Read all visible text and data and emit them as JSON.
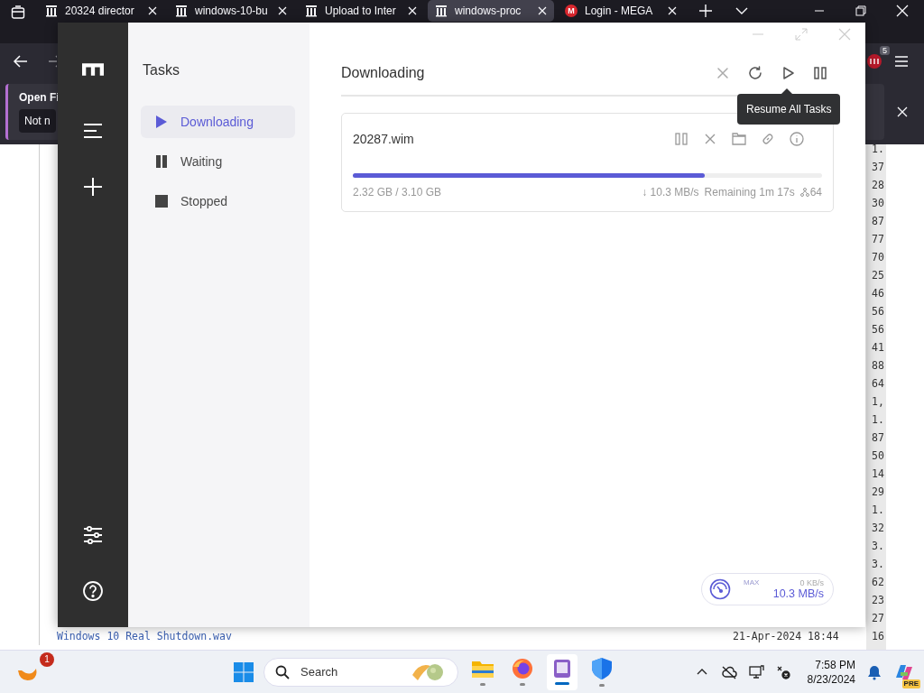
{
  "browser": {
    "tabs": [
      {
        "title": "20324 director",
        "kind": "archive",
        "selected": false
      },
      {
        "title": "windows-10-bu",
        "kind": "archive",
        "selected": false
      },
      {
        "title": "Upload to Inter",
        "kind": "archive",
        "selected": false
      },
      {
        "title": "windows-proc",
        "kind": "archive",
        "selected": true
      },
      {
        "title": "Login - MEGA",
        "kind": "mega",
        "icon_text": "M",
        "selected": false
      }
    ],
    "extension_badge": "5",
    "notification": {
      "title": "Open Fi",
      "button": "Not n"
    },
    "listing": {
      "size_column": [
        "1.",
        "37",
        "28",
        "30",
        "87",
        "77",
        "70",
        "25",
        "46",
        "56",
        "56",
        "41",
        "88",
        "64",
        "1,",
        "1.",
        "87",
        "50",
        "14",
        "29",
        "1.",
        "32",
        "3.",
        "3.",
        "62",
        "23",
        "27"
      ],
      "last_row": {
        "name": "Windows 10 Real Shutdown.wav",
        "date": "21-Apr-2024 18:44",
        "size": "16"
      }
    }
  },
  "app": {
    "sidebar_title": "Tasks",
    "nav": [
      {
        "label": "Downloading",
        "kind": "play",
        "selected": true
      },
      {
        "label": "Waiting",
        "kind": "pause",
        "selected": false
      },
      {
        "label": "Stopped",
        "kind": "stop",
        "selected": false
      }
    ],
    "header": "Downloading",
    "tooltip": "Resume All Tasks",
    "task": {
      "name": "20287.wim",
      "level": 0.75,
      "progress": "2.32 GB / 3.10 GB",
      "speed": "↓ 10.3 MB/s",
      "remaining": "Remaining 1m 17s",
      "connections": "64"
    },
    "speed_meter": {
      "label": "MAX",
      "upload": "0 KB/s",
      "download": "10.3 MB/s"
    }
  },
  "taskbar": {
    "widget_badge": "1",
    "search_placeholder": "Search",
    "apps": [
      {
        "kind": "explorer",
        "selected": false
      },
      {
        "kind": "firefox",
        "selected": false
      },
      {
        "kind": "motrix",
        "selected": true
      },
      {
        "kind": "defender",
        "selected": false
      }
    ],
    "time": "7:58 PM",
    "date": "8/23/2024",
    "copilot_badge": "PRE"
  }
}
